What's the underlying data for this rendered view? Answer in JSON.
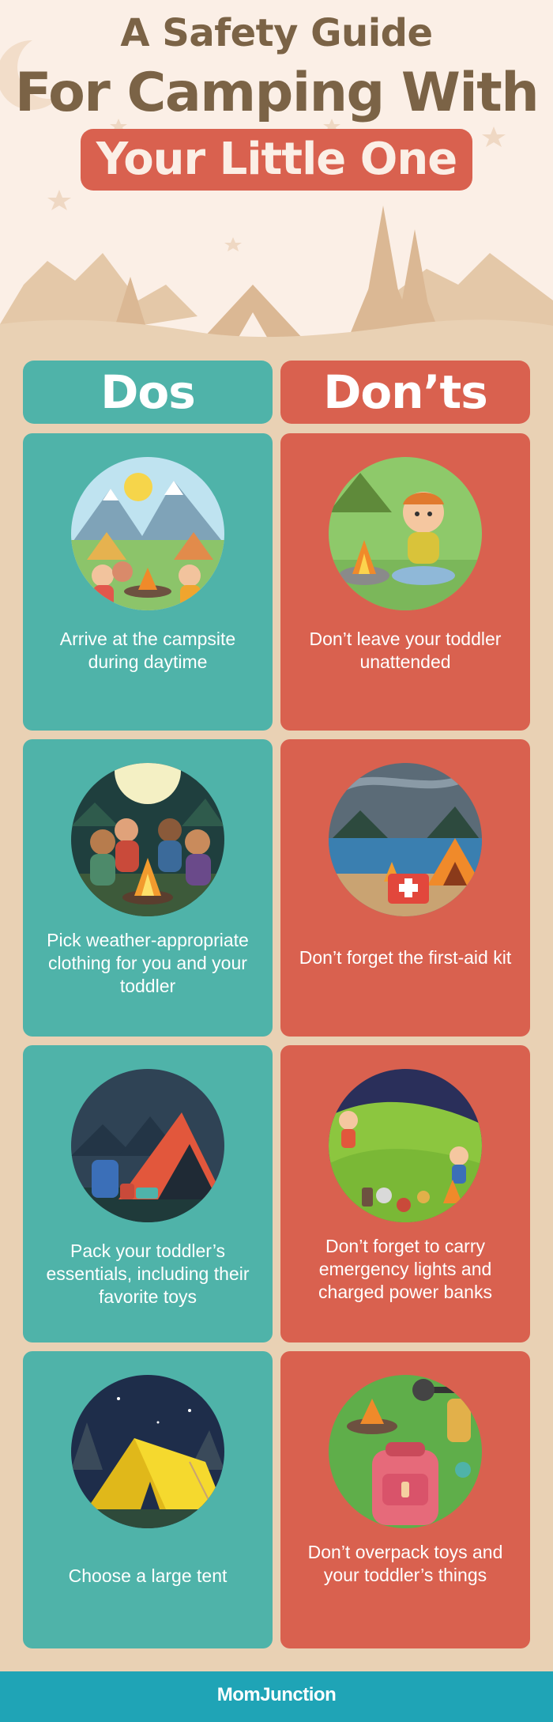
{
  "header": {
    "title_line1": "A Safety Guide",
    "title_line2": "For Camping With",
    "title_line3": "Your Little One"
  },
  "columns": {
    "dos_label": "Dos",
    "donts_label": "Don’ts"
  },
  "dos": [
    {
      "text": "Arrive at the campsite during daytime",
      "icon": "family-campsite-icon"
    },
    {
      "text": "Pick weather-appropriate clothing for you and your toddler",
      "icon": "night-campfire-icon"
    },
    {
      "text": "Pack your toddler’s essentials, including their favorite toys",
      "icon": "tent-backpack-icon"
    },
    {
      "text": "Choose a large tent",
      "icon": "yellow-tent-icon"
    }
  ],
  "donts": [
    {
      "text": "Don’t leave your toddler unattended",
      "icon": "toddler-fire-icon"
    },
    {
      "text": "Don’t forget the first-aid kit",
      "icon": "first-aid-kit-icon"
    },
    {
      "text": "Don’t forget to carry emergency lights and charged power banks",
      "icon": "camping-gear-icon"
    },
    {
      "text": "Don’t overpack toys and your toddler’s things",
      "icon": "backpack-icon"
    }
  ],
  "footer": {
    "logo_text": "MomJunction"
  },
  "colors": {
    "dos": "#4fb3a9",
    "donts": "#d9614f",
    "title": "#7b6346",
    "background": "#e9d1b4",
    "footer": "#1fa4b6"
  }
}
